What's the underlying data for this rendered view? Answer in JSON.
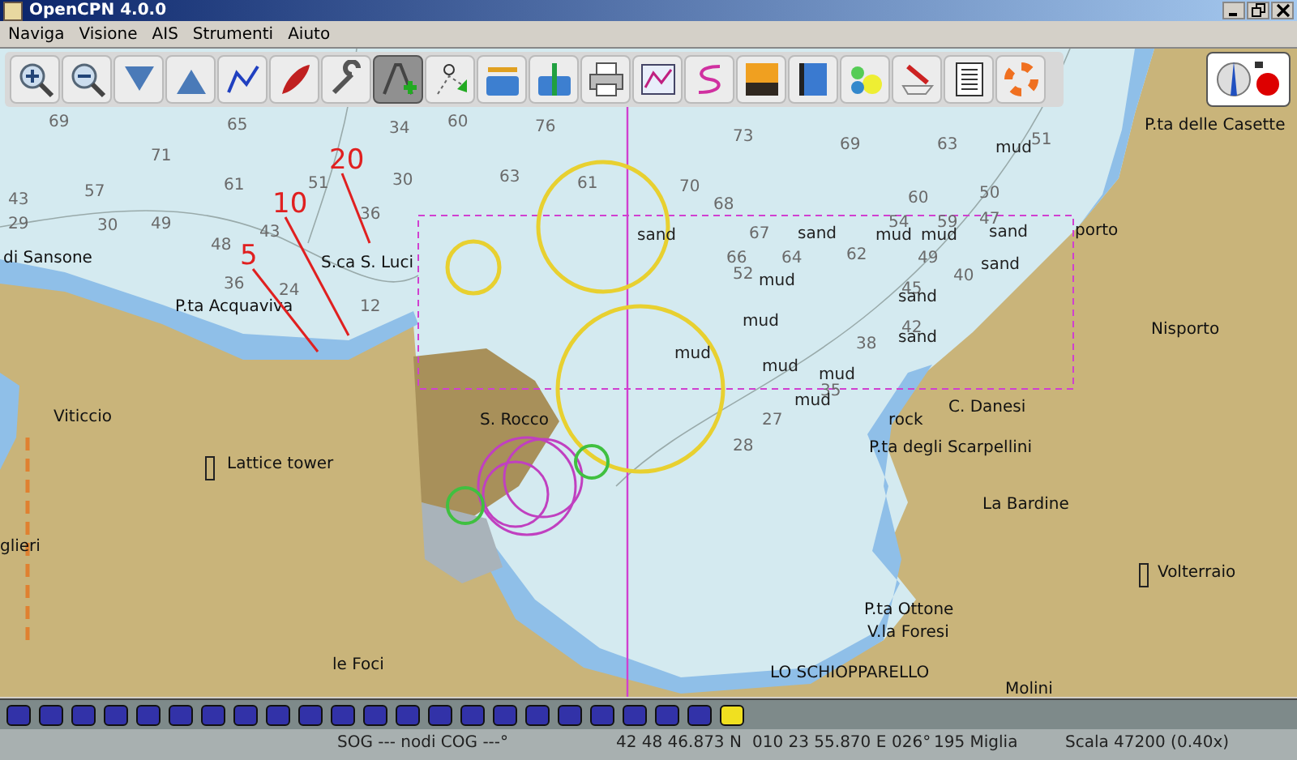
{
  "window": {
    "title": "OpenCPN 4.0.0"
  },
  "menu": [
    "Naviga",
    "Visione",
    "AIS",
    "Strumenti",
    "Aiuto"
  ],
  "toolbar": [
    {
      "kind": "zoom-in",
      "selected": false
    },
    {
      "kind": "zoom-out",
      "selected": false
    },
    {
      "kind": "scale-down",
      "selected": false
    },
    {
      "kind": "scale-up",
      "selected": false
    },
    {
      "kind": "route",
      "selected": false
    },
    {
      "kind": "boat",
      "selected": false
    },
    {
      "kind": "wrench",
      "selected": false
    },
    {
      "kind": "text-plus",
      "selected": true
    },
    {
      "kind": "query",
      "selected": false
    },
    {
      "kind": "tide",
      "selected": false
    },
    {
      "kind": "current",
      "selected": false
    },
    {
      "kind": "print",
      "selected": false
    },
    {
      "kind": "graph",
      "selected": false
    },
    {
      "kind": "track",
      "selected": false
    },
    {
      "kind": "sunset",
      "selected": false
    },
    {
      "kind": "help",
      "selected": false
    },
    {
      "kind": "dashboard",
      "selected": false
    },
    {
      "kind": "ais",
      "selected": false
    },
    {
      "kind": "list",
      "selected": false
    },
    {
      "kind": "lifebuoy",
      "selected": false
    }
  ],
  "chart": {
    "place_names": [
      "P.ta delle Casette",
      "di Sansone",
      "S.ca S. Luci",
      "P.ta Acquaviva",
      "Viticcio",
      "Lattice tower",
      "glieri",
      "S. Rocco",
      "C. Danesi",
      "rock",
      "P.ta degli Scarpellini",
      "La Bardine",
      "Nisporto",
      "porto",
      "Volterraio",
      "P.ta Ottone",
      "V.la Foresi",
      "LO SCHIOPPARELLO",
      "le Foci",
      "Molini"
    ],
    "depths": [
      "69",
      "65",
      "71",
      "61",
      "57",
      "49",
      "43",
      "29",
      "30",
      "48",
      "43",
      "51",
      "36",
      "30",
      "36",
      "24",
      "12",
      "34",
      "60",
      "76",
      "63",
      "61",
      "73",
      "69",
      "63",
      "70",
      "60",
      "50",
      "51",
      "68",
      "66",
      "67",
      "64",
      "62",
      "54",
      "59",
      "47",
      "52",
      "49",
      "45",
      "40",
      "42",
      "38",
      "35",
      "27",
      "28"
    ],
    "seabed": [
      "mud",
      "sand",
      "mud",
      "mud",
      "sand",
      "mud",
      "sand",
      "sand",
      "mud",
      "sand",
      "mud",
      "mud",
      "sand",
      "mud",
      "mud"
    ],
    "annotations": [
      "20",
      "10",
      "5"
    ]
  },
  "chart_bar": [
    {
      "selected": false
    },
    {
      "selected": false
    },
    {
      "selected": false
    },
    {
      "selected": false
    },
    {
      "selected": false
    },
    {
      "selected": false
    },
    {
      "selected": false
    },
    {
      "selected": false
    },
    {
      "selected": false
    },
    {
      "selected": false
    },
    {
      "selected": false
    },
    {
      "selected": false
    },
    {
      "selected": false
    },
    {
      "selected": false
    },
    {
      "selected": false
    },
    {
      "selected": false
    },
    {
      "selected": false
    },
    {
      "selected": false
    },
    {
      "selected": false
    },
    {
      "selected": false
    },
    {
      "selected": false
    },
    {
      "selected": false
    },
    {
      "selected": true
    }
  ],
  "status_bar": {
    "speed_course": "SOG --- nodi COG ---°",
    "latitude": "42 48 46.873 N",
    "longitude": "010 23 55.870 E",
    "bearing": "026°",
    "distance": "195 Miglia",
    "scale": "Scala 47200 (0.40x)"
  }
}
